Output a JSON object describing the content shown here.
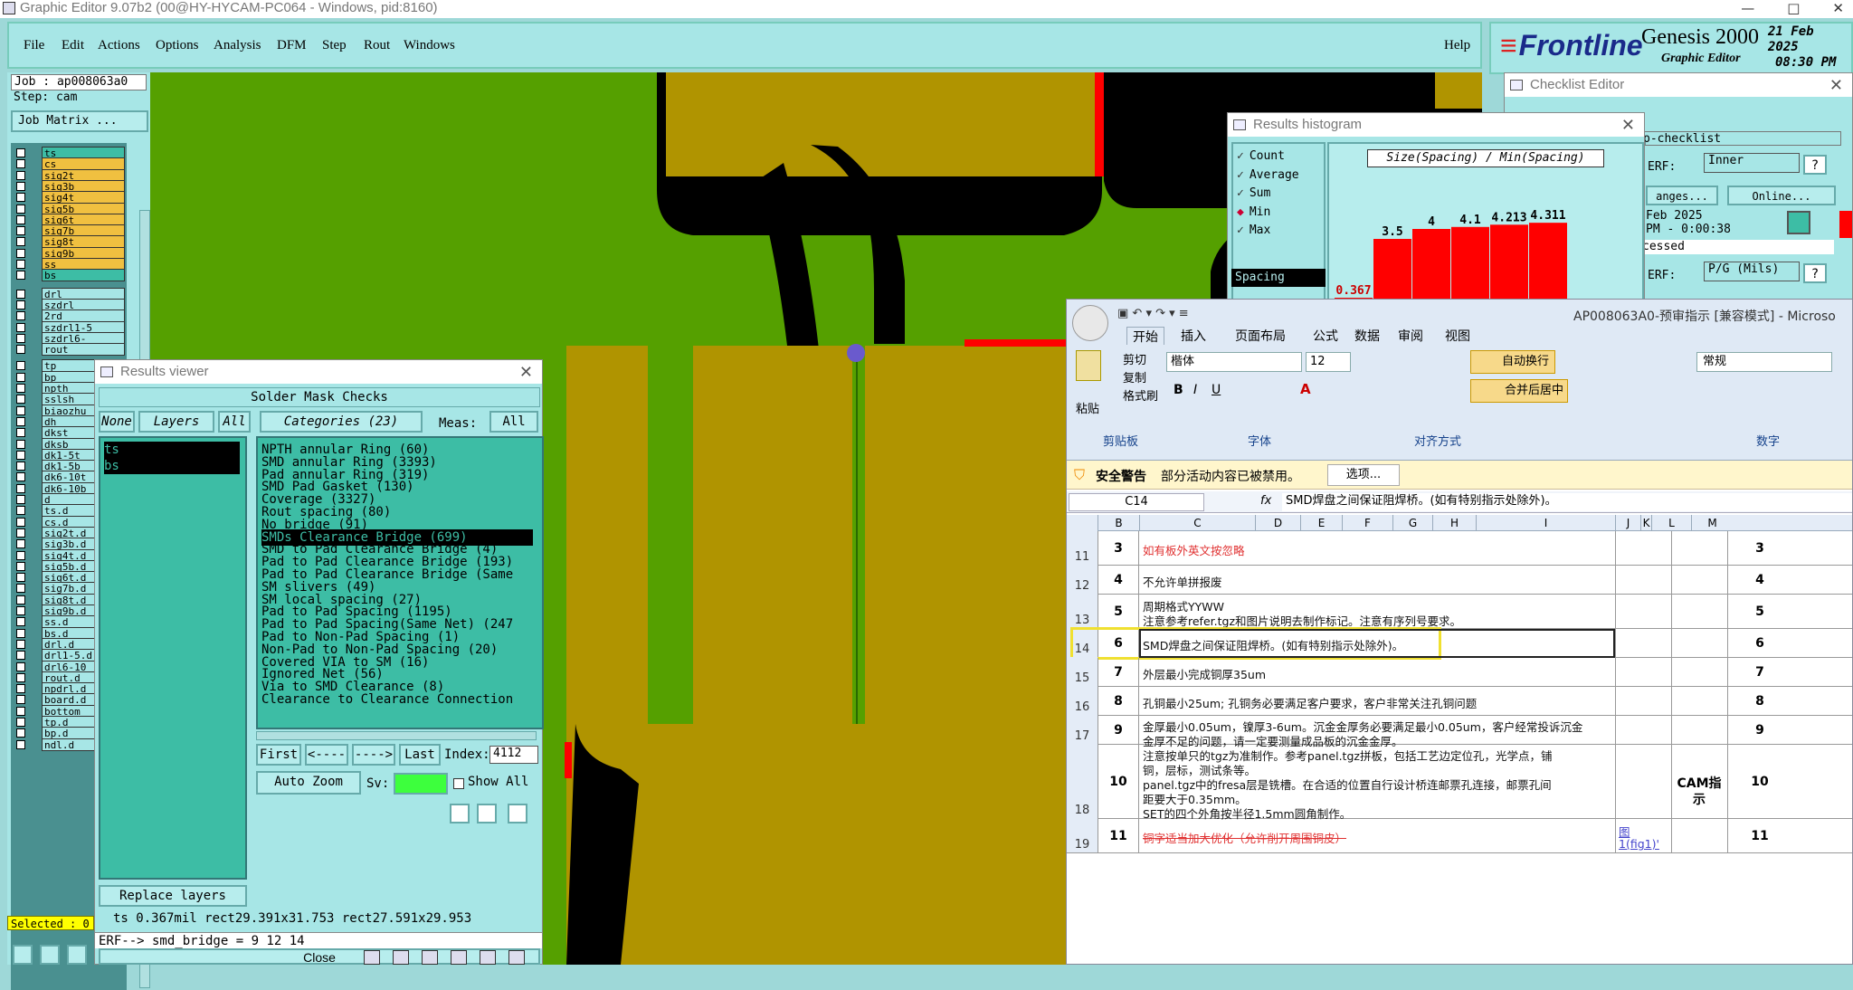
{
  "app": {
    "title": "Graphic Editor 9.07b2 (00@HY-HYCAM-PC064 - Windows, pid:8160)",
    "win_min": "—",
    "win_max": "□",
    "win_close": "✕"
  },
  "menu": [
    "File",
    "Edit",
    "Actions",
    "Options",
    "Analysis",
    "DFM",
    "Step",
    "Rout",
    "Windows"
  ],
  "help": "Help",
  "logo": {
    "brand": "Frontline",
    "product": "Genesis 2000",
    "sub": "Graphic Editor",
    "date": "21 Feb 2025",
    "time": "08:30 PM"
  },
  "job": {
    "job": "Job : ap008063a0",
    "step": "Step: cam",
    "matrix": "Job Matrix ..."
  },
  "layers": [
    "ts",
    "cs",
    "sig2t",
    "sig3b",
    "sig4t",
    "sig5b",
    "sig6t",
    "sig7b",
    "sig8t",
    "sig9b",
    "ss",
    "bs",
    "drl",
    "szdrl",
    "2rd",
    "szdrl1-5",
    "szdrl6-",
    "rout",
    "tp",
    "bp",
    "npth",
    "sslsh",
    "biaozhu",
    "dh",
    "dkst",
    "dksb",
    "dk1-5t",
    "dk1-5b",
    "dk6-10t",
    "dk6-10b",
    "d",
    "ts.d",
    "cs.d",
    "sig2t.d",
    "sig3b.d",
    "sig4t.d",
    "sig5b.d",
    "sig6t.d",
    "sig7b.d",
    "sig8t.d",
    "sig9b.d",
    "ss.d",
    "bs.d",
    "drl.d",
    "drl1-5.d",
    "drl6-10",
    "rout.d",
    "npdrl.d",
    "board.d",
    "bottom_",
    "tp.d",
    "bp.d",
    "ndl.d"
  ],
  "selected": "Selected : 0",
  "results_viewer": {
    "title": "Results viewer",
    "heading": "Solder Mask Checks",
    "none": "None",
    "layers_btn": "Layers",
    "all": "All",
    "categories": "Categories (23)",
    "meas_label": "Meas:",
    "meas_val": "All",
    "layer_items": [
      "ts",
      "bs"
    ],
    "items": [
      "NPTH annular Ring (60)",
      "SMD annular Ring (3393)",
      "Pad annular Ring (319)",
      "SMD Pad Gasket (130)",
      "Coverage (3327)",
      "Rout spacing (80)",
      "No bridge (91)",
      "SMDs Clearance Bridge (699)",
      "SMD to Pad Clearance Bridge (4)",
      "Pad to Pad Clearance Bridge (193)",
      "Pad to Pad Clearance Bridge (Same",
      "SM slivers (49)",
      "SM local spacing (27)",
      "Pad to Pad Spacing (1195)",
      "Pad to Pad Spacing(Same Net) (247",
      "Pad to Non-Pad Spacing (1)",
      "Non-Pad to Non-Pad Spacing (20)",
      "Covered VIA to SM (16)",
      "Ignored Net (56)",
      "Via to SMD Clearance (8)",
      "Clearance to Clearance Connection"
    ],
    "nav": [
      "First",
      "<----",
      "---->",
      "Last"
    ],
    "index_label": "Index:",
    "index_val": "4112",
    "autozoom": "Auto Zoom",
    "sv": "Sv:",
    "showall": "Show All",
    "replace": "Replace layers",
    "status": "ts 0.367mil  rect29.391x31.753  rect27.591x29.953",
    "erf": "ERF--> smd_bridge = 9 12 14",
    "close": "Close"
  },
  "histogram": {
    "title": "Results histogram",
    "opts": [
      "Count",
      "Average",
      "Sum",
      "Min",
      "Max"
    ],
    "selected": "Min",
    "spacing": "Spacing",
    "label": "Size(Spacing) / Min(Spacing)",
    "bars": [
      {
        "label": "0.367",
        "value": 0.367
      },
      {
        "label": "3.5",
        "value": 3.5
      },
      {
        "label": "4",
        "value": 4
      },
      {
        "label": "4.1",
        "value": 4.1
      },
      {
        "label": "4.213",
        "value": 4.213
      },
      {
        "label": "4.311",
        "value": 4.311
      }
    ]
  },
  "checklist": {
    "title": "Checklist Editor",
    "name": "p-checklist",
    "erf": "ERF:",
    "erf_val": "Inner",
    "changes": "anges...",
    "online": "Online...",
    "date": "Feb 2025",
    "time": "PM - 0:00:38",
    "status": "cessed",
    "erf2_val": "P/G (Mils)",
    "q": "?"
  },
  "excel": {
    "title": "AP008063A0-预审指示 [兼容模式] - Microso",
    "tabs": [
      "开始",
      "插入",
      "页面布局",
      "公式",
      "数据",
      "审阅",
      "视图"
    ],
    "paste": "粘贴",
    "cut": "剪切",
    "copy": "复制",
    "format": "格式刷",
    "clipboard": "剪贴板",
    "font": "楷体",
    "size": "12",
    "font_group": "字体",
    "align_group": "对齐方式",
    "wrap": "自动换行",
    "merge": "合并后居中",
    "numfmt": "常规",
    "num_group": "数字",
    "sec_title": "安全警告",
    "sec_msg": "部分活动内容已被禁用。",
    "sec_btn": "选项...",
    "cellref": "C14",
    "fx": "fx",
    "formula": "SMD焊盘之间保证阻焊桥。(如有特别指示处除外)。",
    "cols": [
      "B",
      "C",
      "D",
      "E",
      "F",
      "G",
      "H",
      "I",
      "J",
      "K",
      "L",
      "M"
    ],
    "cam": "CAM指示",
    "rows": [
      {
        "rn": "11",
        "n": "3",
        "text": "如有板外英文按忽略",
        "red": true
      },
      {
        "rn": "12",
        "n": "4",
        "text": "不允许单拼报废"
      },
      {
        "rn": "13",
        "n": "5",
        "text": "周期格式YYWW",
        "text2": "注意参考refer.tgz和图片说明去制作标记。注意有序列号要求。"
      },
      {
        "rn": "14",
        "n": "6",
        "text": "SMD焊盘之间保证阻焊桥。(如有特别指示处除外)。"
      },
      {
        "rn": "15",
        "n": "7",
        "text": "外层最小完成铜厚35um"
      },
      {
        "rn": "16",
        "n": "8",
        "text": "孔铜最小25um; 孔铜务必要满足客户要求，客户非常关注孔铜问题"
      },
      {
        "rn": "17",
        "n": "9",
        "text": "金厚最小0.05um，镍厚3-6um。沉金金厚务必要满足最小0.05um，客户经常投诉沉金",
        "text2": "金厚不足的问题，请一定要测量成品板的沉金金厚。"
      },
      {
        "rn": "18",
        "n": "10",
        "text": "注意按单只的tgz为准制作。参考panel.tgz拼板，包括工艺边定位孔，光学点，铺",
        "text2": "铜，层标，测试条等。",
        "text3": "panel.tgz中的fresa层是铣槽。在合适的位置自行设计桥连邮票孔连接，邮票孔间",
        "text4": "距要大于0.35mm。",
        "text5": "SET的四个外角按半径1.5mm圆角制作。"
      },
      {
        "rn": "19",
        "n": "11",
        "text": "铜字适当加大优化（允许削开周围铜皮）",
        "red": true,
        "strike": true,
        "link": "图",
        "link2": "1(fig1)'"
      }
    ],
    "mcol": [
      "3",
      "4",
      "5",
      "6",
      "7",
      "8",
      "9",
      "10",
      "11"
    ]
  }
}
